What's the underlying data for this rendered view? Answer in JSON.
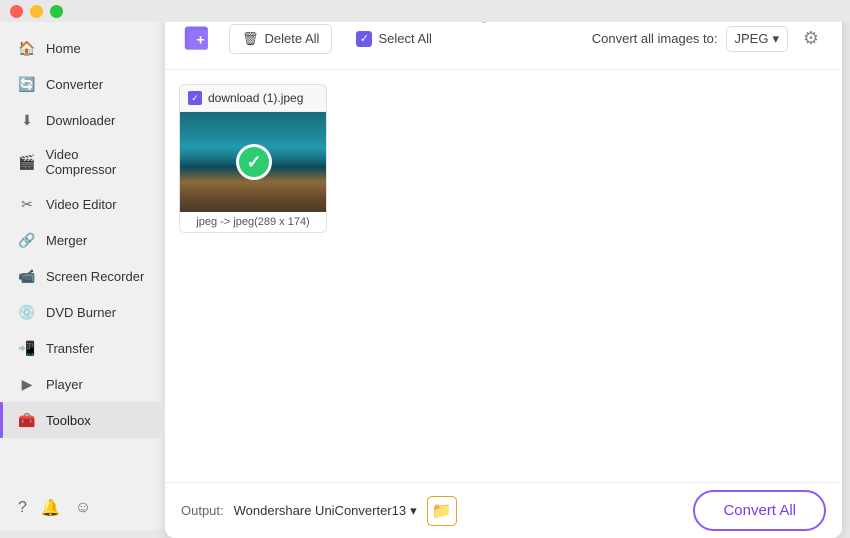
{
  "app": {
    "title": "Image Converter"
  },
  "window": {
    "traffic_lights": [
      "red",
      "yellow",
      "green"
    ]
  },
  "sidebar": {
    "items": [
      {
        "id": "home",
        "label": "Home",
        "icon": "🏠"
      },
      {
        "id": "converter",
        "label": "Converter",
        "icon": "🔄"
      },
      {
        "id": "downloader",
        "label": "Downloader",
        "icon": "⬇"
      },
      {
        "id": "video-compressor",
        "label": "Video Compressor",
        "icon": "🎬"
      },
      {
        "id": "video-editor",
        "label": "Video Editor",
        "icon": "✂"
      },
      {
        "id": "merger",
        "label": "Merger",
        "icon": "🔗"
      },
      {
        "id": "screen-recorder",
        "label": "Screen Recorder",
        "icon": "📹"
      },
      {
        "id": "dvd-burner",
        "label": "DVD Burner",
        "icon": "💿"
      },
      {
        "id": "transfer",
        "label": "Transfer",
        "icon": "📲"
      },
      {
        "id": "player",
        "label": "Player",
        "icon": "▶"
      },
      {
        "id": "toolbox",
        "label": "Toolbox",
        "icon": "🧰",
        "active": true
      }
    ],
    "bottom": [
      {
        "id": "help",
        "icon": "?"
      },
      {
        "id": "bell",
        "icon": "🔔"
      },
      {
        "id": "feedback",
        "icon": "💬"
      }
    ]
  },
  "toolbar": {
    "delete_all": "Delete All",
    "select_all": "Select All",
    "convert_format_label": "Convert all images to:",
    "format": "JPEG"
  },
  "file": {
    "name": "download (1).jpeg",
    "info": "jpeg -> jpeg(289 x 174)"
  },
  "bottom_bar": {
    "output_label": "Output:",
    "output_folder": "Wondershare UniConverter13",
    "convert_all": "Convert All"
  }
}
